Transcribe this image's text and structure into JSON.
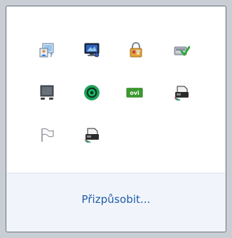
{
  "tray": {
    "customize_link": "Přizpůsobit...",
    "icons": [
      {
        "name": "network-user-icon"
      },
      {
        "name": "monitor-network-icon"
      },
      {
        "name": "security-lock-icon"
      },
      {
        "name": "hardware-check-icon"
      },
      {
        "name": "display-device-icon"
      },
      {
        "name": "green-target-icon"
      },
      {
        "name": "ovi-badge-icon",
        "label": "ovi"
      },
      {
        "name": "printer-icon"
      },
      {
        "name": "action-center-flag-icon"
      },
      {
        "name": "printer-icon"
      }
    ]
  },
  "colors": {
    "link": "#1e5aa8",
    "footer_bg": "#f1f5fb",
    "border": "#6f7780"
  }
}
